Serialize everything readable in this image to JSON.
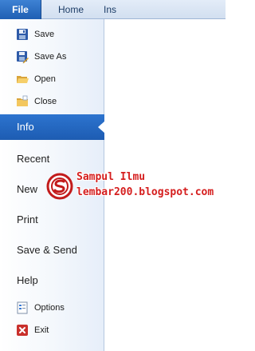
{
  "ribbon": {
    "tabs": [
      {
        "label": "File",
        "selected": true
      },
      {
        "label": "Home",
        "selected": false
      },
      {
        "label": "Ins",
        "selected": false
      }
    ]
  },
  "backstage": {
    "commands": [
      {
        "label": "Save",
        "icon": "save-icon"
      },
      {
        "label": "Save As",
        "icon": "save-as-icon"
      },
      {
        "label": "Open",
        "icon": "open-folder-icon"
      },
      {
        "label": "Close",
        "icon": "close-folder-icon"
      }
    ],
    "sections": [
      {
        "label": "Info",
        "selected": true
      },
      {
        "label": "Recent",
        "selected": false
      },
      {
        "label": "New",
        "selected": false
      },
      {
        "label": "Print",
        "selected": false
      },
      {
        "label": "Save & Send",
        "selected": false
      },
      {
        "label": "Help",
        "selected": false
      }
    ],
    "footer_commands": [
      {
        "label": "Options",
        "icon": "options-icon"
      },
      {
        "label": "Exit",
        "icon": "exit-icon"
      }
    ]
  },
  "watermark": {
    "line1": "Sampul Ilmu",
    "line2": "lembar200.blogspot.com"
  },
  "colors": {
    "file_tab": "#1f5fb3",
    "selected_section": "#2d74cf",
    "watermark_text": "#d51e1e"
  }
}
